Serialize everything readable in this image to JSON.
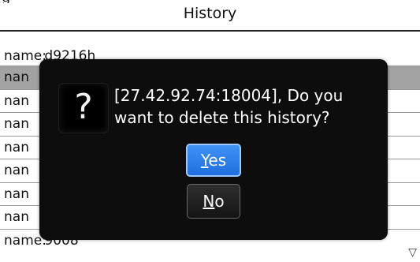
{
  "header": {
    "title": "History"
  },
  "list": {
    "rows": [
      {
        "label": "name:",
        "value": "d9216h"
      },
      {
        "label": "nan",
        "value": ""
      },
      {
        "label": "nan",
        "value": ""
      },
      {
        "label": "nan",
        "value": ""
      },
      {
        "label": "nan",
        "value": ""
      },
      {
        "label": "nan",
        "value": ""
      },
      {
        "label": "nan",
        "value": ""
      },
      {
        "label": "nan",
        "value": ""
      },
      {
        "label": "name:",
        "value": "9008"
      }
    ],
    "selected_index": 1
  },
  "dialog": {
    "message": "[27.42.92.74:18004], Do you want to delete this history?",
    "icon": "question-icon",
    "icon_glyph": "?",
    "yes": {
      "mnemonic": "Y",
      "rest": "es"
    },
    "no": {
      "mnemonic": "N",
      "rest": "o"
    }
  },
  "scroll_arrow": "▽"
}
